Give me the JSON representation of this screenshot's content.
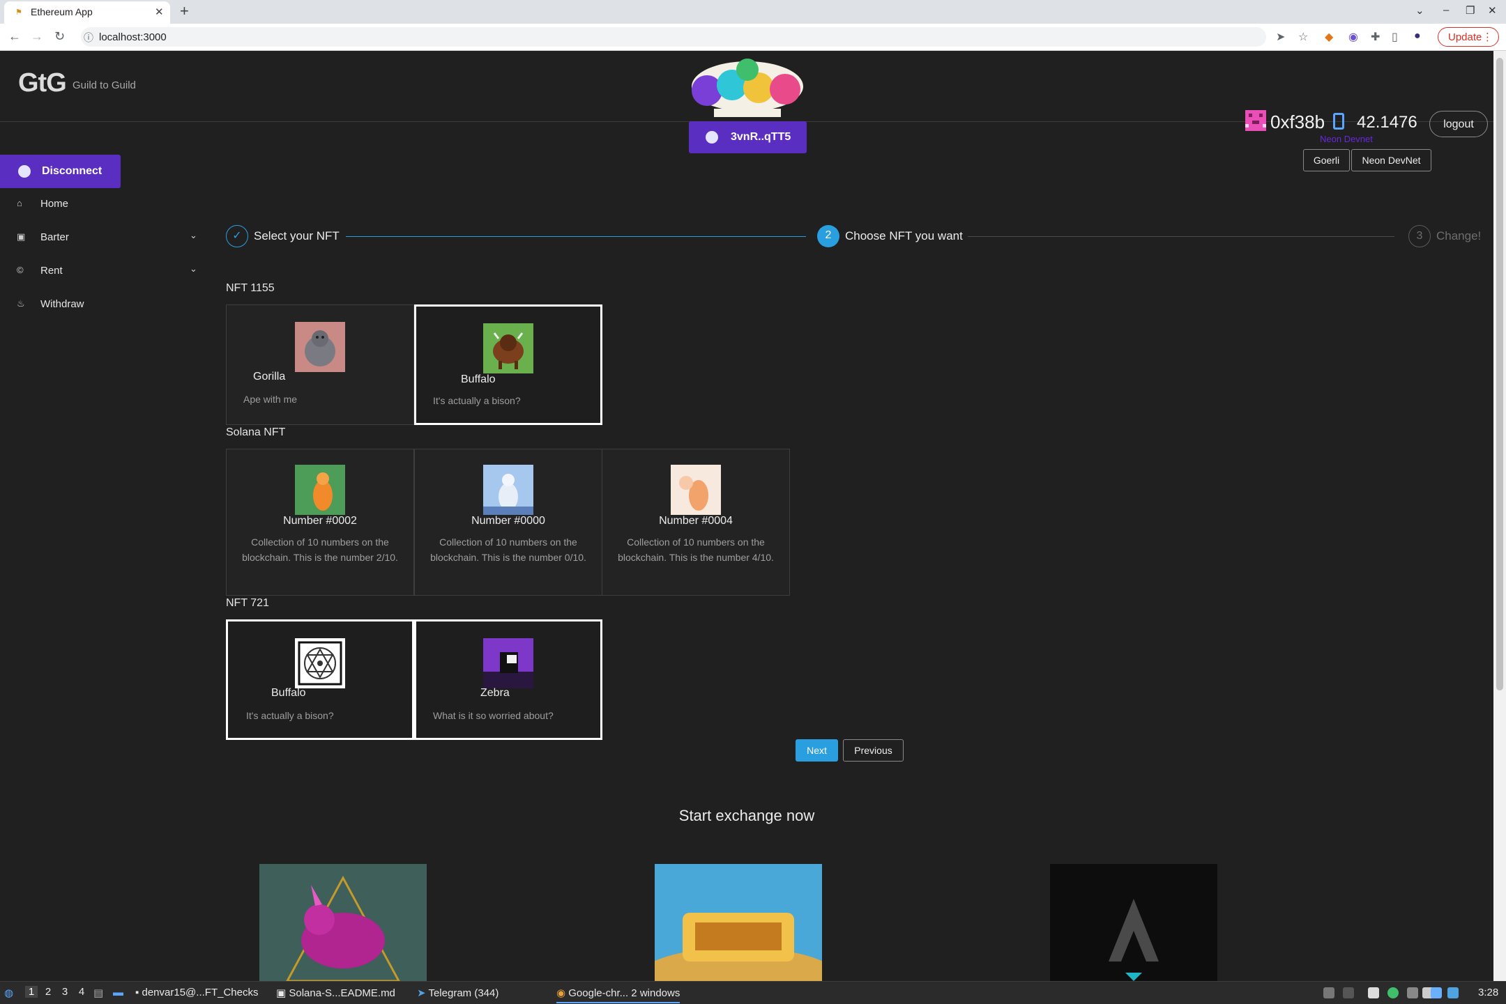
{
  "browser": {
    "tab_title": "Ethereum App",
    "new_tab_symbol": "+",
    "url": "localhost:3000",
    "update_label": "Update"
  },
  "header": {
    "logo": "GtG",
    "logo_subtitle": "Guild to Guild",
    "wallet_address_short": "3vnR..qTT5",
    "account_address": "0xf38b",
    "balance": "42.1476",
    "network_name": "Neon Devnet",
    "logout_label": "logout",
    "network_buttons": [
      "Goerli",
      "Neon DevNet"
    ]
  },
  "sidebar": {
    "disconnect_label": "Disconnect",
    "items": [
      {
        "label": "Home",
        "icon": "home-icon"
      },
      {
        "label": "Barter",
        "icon": "barter-icon"
      },
      {
        "label": "Rent",
        "icon": "rent-icon"
      },
      {
        "label": "Withdraw",
        "icon": "withdraw-icon"
      }
    ]
  },
  "steps": [
    {
      "label": "Select your NFT",
      "marker": "✓",
      "state": "done"
    },
    {
      "label": "Choose NFT you want",
      "marker": "2",
      "state": "active"
    },
    {
      "label": "Change!",
      "marker": "3",
      "state": "pending"
    }
  ],
  "sections": {
    "nft1155": {
      "title": "NFT 1155",
      "cards": [
        {
          "name": "Gorilla",
          "description": "Ape with me",
          "selected": false
        },
        {
          "name": "Buffalo",
          "description": "It's actually a bison?",
          "selected": true
        }
      ]
    },
    "solana": {
      "title": "Solana NFT",
      "cards": [
        {
          "name": "Number #0002",
          "description": "Collection of 10 numbers on the blockchain. This is the number 2/10.",
          "selected": false
        },
        {
          "name": "Number #0000",
          "description": "Collection of 10 numbers on the blockchain. This is the number 0/10.",
          "selected": false
        },
        {
          "name": "Number #0004",
          "description": "Collection of 10 numbers on the blockchain. This is the number 4/10.",
          "selected": false
        }
      ]
    },
    "nft721": {
      "title": "NFT 721",
      "cards": [
        {
          "name": "Buffalo",
          "description": "It's actually a bison?",
          "selected": true
        },
        {
          "name": "Zebra",
          "description": "What is it so worried about?",
          "selected": true
        }
      ]
    }
  },
  "actions": {
    "next_label": "Next",
    "previous_label": "Previous"
  },
  "footer": {
    "title": "Start exchange now"
  },
  "taskbar": {
    "workspaces": [
      "1",
      "2",
      "3",
      "4"
    ],
    "items": [
      "denvar15@...FT_Checks",
      "Solana-S...EADME.md",
      "Telegram (344)",
      "Google-chr... 2 windows"
    ],
    "clock": "3:28"
  },
  "colors": {
    "accent_purple": "#5b2ec2",
    "accent_blue": "#2a9fe0",
    "background": "#202020"
  }
}
